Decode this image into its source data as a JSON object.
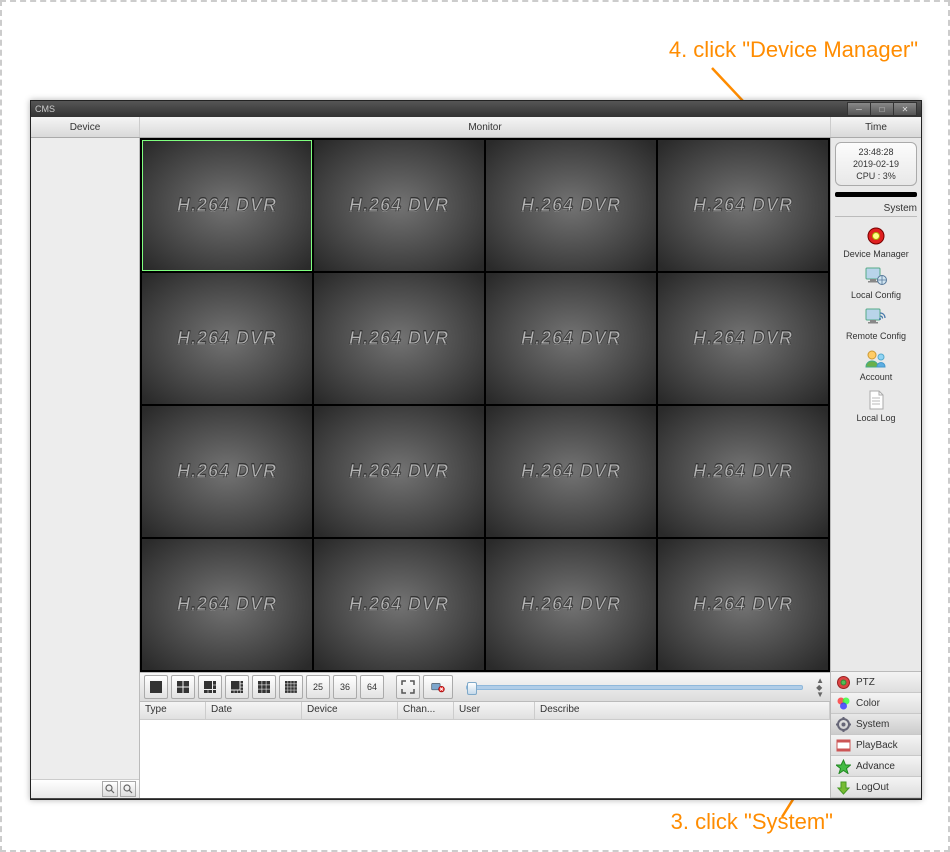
{
  "annotations": {
    "top": "4. click \"Device Manager\"",
    "bottom": "3. click \"System\""
  },
  "app": {
    "title": "CMS"
  },
  "header": {
    "device": "Device",
    "monitor": "Monitor",
    "time": "Time"
  },
  "info": {
    "clock": "23:48:28",
    "date": "2019-02-19",
    "cpu": "CPU : 3%"
  },
  "grid": {
    "cell_label": "H.264 DVR"
  },
  "toolbar_nums": {
    "n25": "25",
    "n36": "36",
    "n64": "64"
  },
  "log_cols": {
    "type": "Type",
    "date": "Date",
    "device": "Device",
    "channel": "Chan...",
    "user": "User",
    "describe": "Describe"
  },
  "section": {
    "system": "System"
  },
  "system_items": {
    "device_manager": "Device Manager",
    "local_config": "Local Config",
    "remote_config": "Remote Config",
    "account": "Account",
    "local_log": "Local Log"
  },
  "tabs": {
    "ptz": "PTZ",
    "color": "Color",
    "system": "System",
    "playback": "PlayBack",
    "advance": "Advance",
    "logout": "LogOut"
  }
}
